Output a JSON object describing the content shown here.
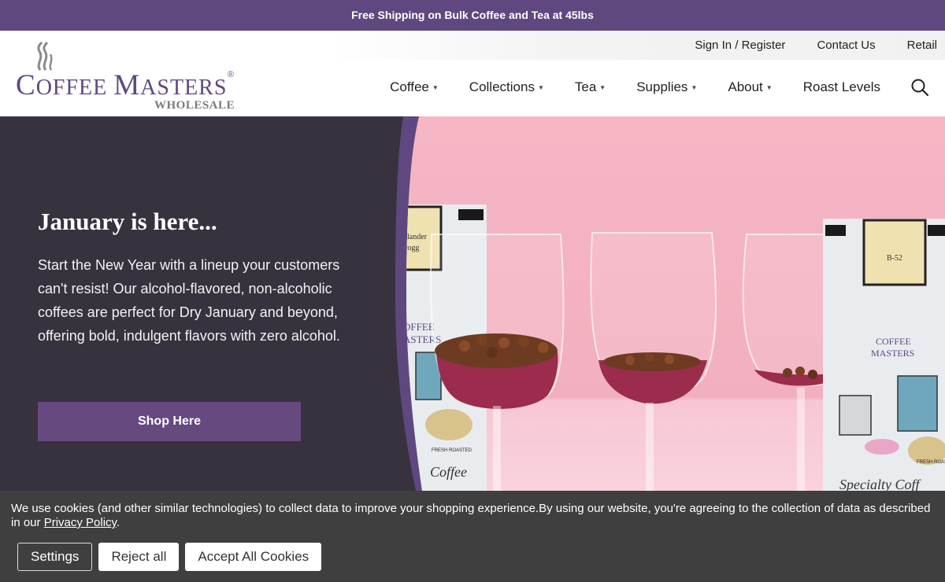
{
  "promo": {
    "text": "Free Shipping on Bulk Coffee and Tea at 45lbs"
  },
  "utility_nav": {
    "sign_in": "Sign In / Register",
    "contact": "Contact Us",
    "retail": "Retail"
  },
  "logo": {
    "word1_initial": "C",
    "word1_rest": "OFFEE",
    "word2_initial": "M",
    "word2_rest": "ASTERS",
    "reg": "®",
    "sub": "WHOLESALE"
  },
  "main_nav": {
    "coffee": "Coffee",
    "collections": "Collections",
    "tea": "Tea",
    "supplies": "Supplies",
    "about": "About",
    "roast_levels": "Roast Levels",
    "caret": "▼"
  },
  "hero": {
    "title": "January is here...",
    "body": "Start the New Year with a lineup your customers can't resist! Our alcohol-flavored, non-alcoholic coffees are perfect for Dry January and beyond, offering bold, indulgent flavors with zero alcohol.",
    "cta": "Shop Here",
    "bag_left_label": "hlander",
    "bag_left_label2": "rogg",
    "bag_left_brand": "OFFEE\nASTERS",
    "bag_left_script": "Coffee",
    "bag_left_fresh": "FRESH ROASTED",
    "bag_right_label": "B-52",
    "bag_right_brand1": "COFFEE",
    "bag_right_brand2": "MASTERS",
    "bag_right_script": "Specialty Coff",
    "bag_right_fresh": "FRESH ROASTED"
  },
  "cookie": {
    "text_before": "We use cookies (and other similar technologies) to collect data to improve your shopping experience.By using our website, you're agreeing to the collection of data as described in our ",
    "link": "Privacy Policy",
    "text_after": ".",
    "settings": "Settings",
    "reject": "Reject all",
    "accept": "Accept All Cookies"
  },
  "colors": {
    "brand": "#5f4880",
    "hero_bg": "#38323f",
    "cookie_bg": "#3f3f3f",
    "photo_pink": "#f4b9c6"
  }
}
